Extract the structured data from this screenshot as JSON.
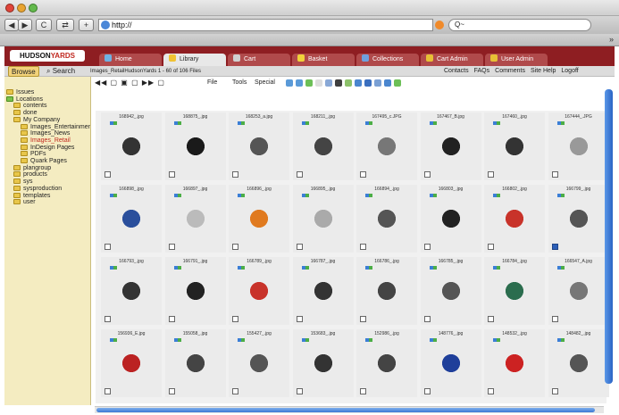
{
  "browser": {
    "url": "http://",
    "search_placeholder": "Q~",
    "nav_back": "◀",
    "nav_forward": "▶",
    "reload": "C",
    "add": "+",
    "bookmarks_more": "»"
  },
  "app": {
    "logo_left": "HUDSON",
    "logo_right": "YARDS",
    "tabs": [
      {
        "label": "Home",
        "color": "#6fb2e3"
      },
      {
        "label": "Library",
        "color": "#f1c232"
      },
      {
        "label": "Cart",
        "color": "#d0d0d0"
      },
      {
        "label": "Basket",
        "color": "#f0d23a"
      },
      {
        "label": "Collections",
        "color": "#6fa0de"
      },
      {
        "label": "Cart Admin",
        "color": "#e7c035"
      },
      {
        "label": "User Admin",
        "color": "#e7c035"
      }
    ]
  },
  "subbar": {
    "browse": "Browse",
    "search": "Search",
    "breadcrumb": "Images_RetailHudsonYards  1 - 60 of 106 Files",
    "links": [
      "Contacts",
      "FAQs",
      "Comments",
      "Site Help",
      "Logoff"
    ]
  },
  "toolbar": {
    "pager": "◀◀ ▢ ▣ ▢ ▶▶ ▢",
    "menus": [
      "File",
      "Tools",
      "Special"
    ]
  },
  "sidebar": {
    "items": [
      {
        "label": "Issues",
        "indent": 0
      },
      {
        "label": "Locations",
        "indent": 0
      },
      {
        "label": "contents",
        "indent": 1
      },
      {
        "label": "done",
        "indent": 1
      },
      {
        "label": "My Company",
        "indent": 1
      },
      {
        "label": "Images_Entertainment",
        "indent": 2
      },
      {
        "label": "Images_News",
        "indent": 2
      },
      {
        "label": "Images_Retail",
        "indent": 2,
        "selected": true
      },
      {
        "label": "InDesign Pages",
        "indent": 2
      },
      {
        "label": "PDFs",
        "indent": 2
      },
      {
        "label": "Quark Pages",
        "indent": 2
      },
      {
        "label": "plangroup",
        "indent": 1
      },
      {
        "label": "products",
        "indent": 1
      },
      {
        "label": "sys",
        "indent": 1
      },
      {
        "label": "sysproduction",
        "indent": 1
      },
      {
        "label": "templates",
        "indent": 1
      },
      {
        "label": "user",
        "indent": 1
      }
    ]
  },
  "files": [
    {
      "name": "168942_.jpg",
      "checked": false
    },
    {
      "name": "168875_.jpg",
      "checked": false
    },
    {
      "name": "168253_a.jpg",
      "checked": false
    },
    {
      "name": "168211_.jpg",
      "checked": false
    },
    {
      "name": "167495_c.JPG",
      "checked": false
    },
    {
      "name": "167467_B.jpg",
      "checked": false
    },
    {
      "name": "167460_.jpg",
      "checked": false
    },
    {
      "name": "167444_.JPG",
      "checked": false
    },
    {
      "name": "166898_.jpg",
      "checked": false
    },
    {
      "name": "166897_.jpg",
      "checked": false
    },
    {
      "name": "166896_.jpg",
      "checked": false
    },
    {
      "name": "166895_.jpg",
      "checked": false
    },
    {
      "name": "166894_.jpg",
      "checked": false
    },
    {
      "name": "166803_.jpg",
      "checked": false
    },
    {
      "name": "166802_.jpg",
      "checked": false
    },
    {
      "name": "166799_.jpg",
      "checked": true
    },
    {
      "name": "166793_.jpg",
      "checked": false
    },
    {
      "name": "166791_.jpg",
      "checked": false
    },
    {
      "name": "166789_.jpg",
      "checked": false
    },
    {
      "name": "166787_.jpg",
      "checked": false
    },
    {
      "name": "166786_.jpg",
      "checked": false
    },
    {
      "name": "166785_.jpg",
      "checked": false
    },
    {
      "name": "166784_.jpg",
      "checked": false
    },
    {
      "name": "166547_A.jpg",
      "checked": false
    },
    {
      "name": "156936_E.jpg",
      "checked": false
    },
    {
      "name": "155058_.jpg",
      "checked": false
    },
    {
      "name": "155427_.jpg",
      "checked": false
    },
    {
      "name": "153683_.jpg",
      "checked": false
    },
    {
      "name": "152986_.jpg",
      "checked": false
    },
    {
      "name": "148776_.jpg",
      "checked": false
    },
    {
      "name": "148532_.jpg",
      "checked": false
    },
    {
      "name": "148482_.jpg",
      "checked": false
    }
  ]
}
